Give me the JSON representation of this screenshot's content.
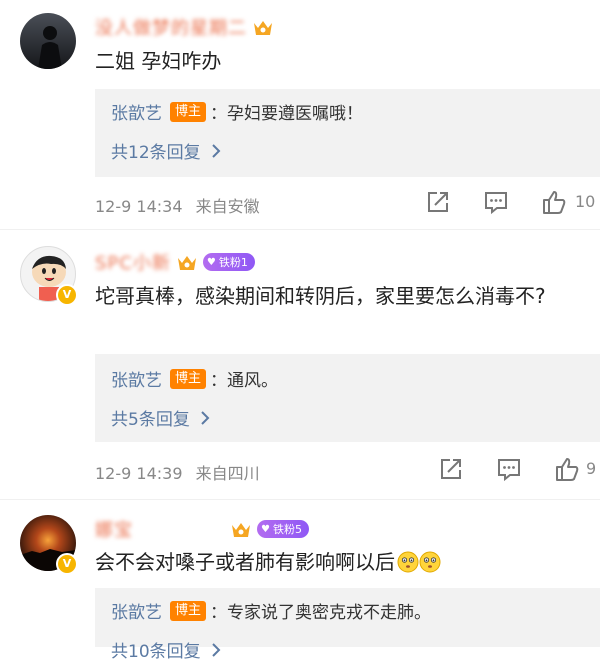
{
  "comments": [
    {
      "username": "没人做梦的星期二",
      "content": "二姐 孕妇咋办",
      "reply": {
        "name": "张歆艺",
        "badge": "博主",
        "text": "：孕妇要遵医嘱哦！"
      },
      "more": "共12条回复",
      "date": "12-9 14:34",
      "source": "来自安徽",
      "likes": "10"
    },
    {
      "username": "SPC小新",
      "fan_level": "铁粉1",
      "content": "坨哥真棒，感染期间和转阴后，家里要怎么消毒不?",
      "reply": {
        "name": "张歆艺",
        "badge": "博主",
        "text": "：通风。"
      },
      "more": "共5条回复",
      "date": "12-9 14:39",
      "source": "来自四川",
      "likes": "9"
    },
    {
      "username": "娜宝",
      "fan_level": "铁粉5",
      "content": "会不会对嗓子或者肺有影响啊以后",
      "reply": {
        "name": "张歆艺",
        "badge": "博主",
        "text": "：专家说了奥密克戎不走肺。"
      },
      "more": "共10条回复"
    }
  ],
  "icons": {
    "forward": "forward-icon",
    "comment": "comment-icon",
    "like": "like-icon",
    "chevron": "chevron-right-icon",
    "crown": "crown-icon",
    "verified": "verified-v-icon",
    "emoji": "embarrassed-emoji-icon"
  },
  "colors": {
    "link_blue": "#5b7aa3",
    "host_orange": "#ff8200",
    "reply_bg": "#f2f2f2",
    "meta_gray": "#888888",
    "fan_purple": "#9b5cf5"
  }
}
